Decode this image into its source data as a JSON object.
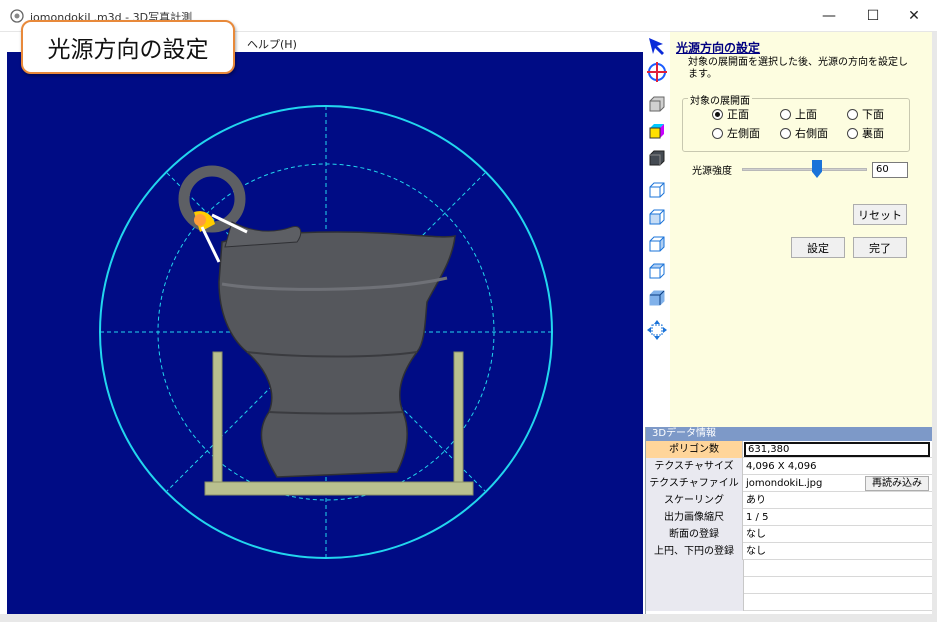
{
  "window": {
    "title": "jomondokiL.m3d - 3D写真計測",
    "minimize": "—",
    "maximize": "☐",
    "close": "✕"
  },
  "menu": {
    "help": "ヘルプ(H)"
  },
  "callout": {
    "text": "光源方向の設定"
  },
  "toolbar": {
    "icons": [
      "select-arrow-icon",
      "crosshair-icon",
      "front-cube-icon",
      "color-cube-icon",
      "dark-cube-icon",
      "wire-cube-1-icon",
      "wire-cube-2-icon",
      "wire-cube-3-icon",
      "wire-cube-4-icon",
      "wire-cube-5-icon",
      "move-arrows-icon"
    ],
    "colors": {
      "arrow": "#0b2ad9",
      "target": "#1b5cff",
      "accent": "#1a73d9"
    }
  },
  "panel": {
    "title": "光源方向の設定",
    "description": "対象の展開面を選択した後、光源の方向を設定します。",
    "group_label": "対象の展開面",
    "radios": [
      {
        "label": "正面",
        "checked": true
      },
      {
        "label": "上面",
        "checked": false
      },
      {
        "label": "下面",
        "checked": false
      },
      {
        "label": "左側面",
        "checked": false
      },
      {
        "label": "右側面",
        "checked": false
      },
      {
        "label": "裏面",
        "checked": false
      }
    ],
    "slider_label": "光源強度",
    "slider_value": "60",
    "slider_fraction": 0.6,
    "reset": "リセット",
    "set": "設定",
    "done": "完了"
  },
  "info": {
    "header": "3Dデータ情報",
    "rows": [
      {
        "key": "ポリゴン数",
        "value": "631,380",
        "selected": true
      },
      {
        "key": "テクスチャサイズ",
        "value": "4,096 X 4,096"
      },
      {
        "key": "テクスチャファイル名",
        "value": "jomondokiL.jpg",
        "button": "再読み込み"
      },
      {
        "key": "スケーリング",
        "value": "あり"
      },
      {
        "key": "出力画像縮尺",
        "value": "1 / 5"
      },
      {
        "key": "断面の登録",
        "value": "なし"
      },
      {
        "key": "上円、下円の登録",
        "value": "なし"
      }
    ]
  },
  "viewport": {
    "background": "#000c85",
    "guide_color": "#22d6ee",
    "pottery_color": "#5a5c60",
    "stand_color": "#b9c08f",
    "light_color": "#ffcc00"
  }
}
